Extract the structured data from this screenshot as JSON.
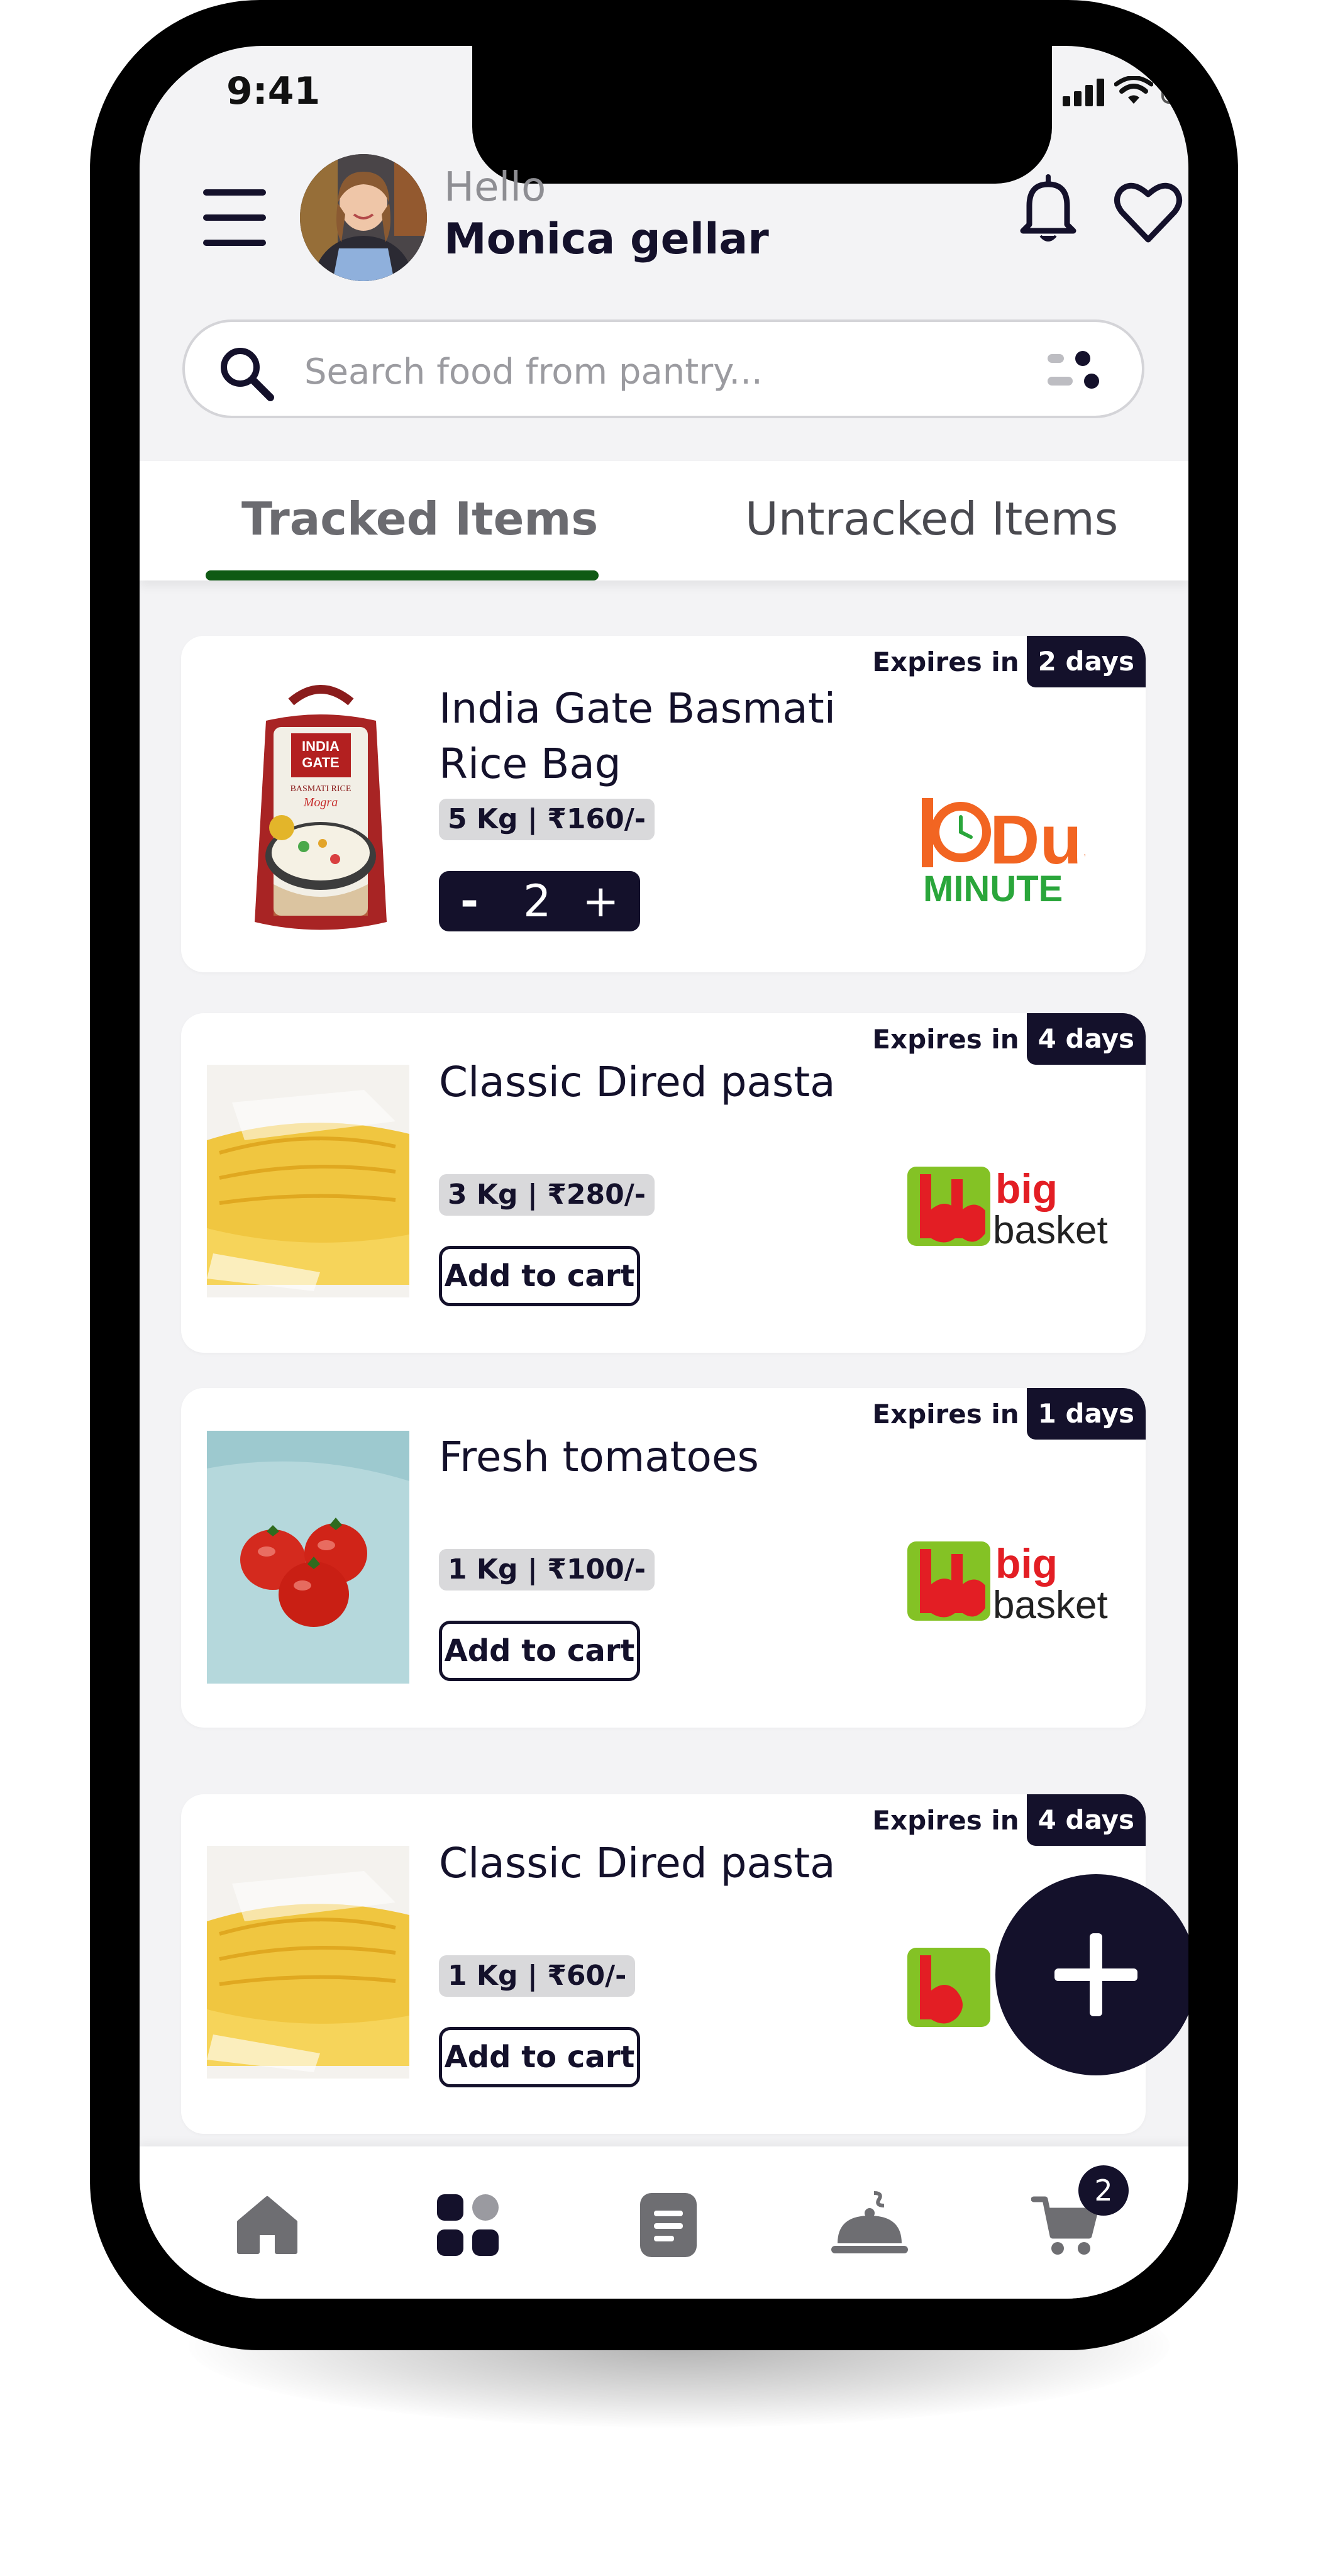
{
  "status_bar": {
    "time": "9:41"
  },
  "header": {
    "greeting": "Hello",
    "user_name": "Monica gellar"
  },
  "search": {
    "placeholder": "Search food from pantry..."
  },
  "tabs": [
    {
      "label": "Tracked Items",
      "active": true
    },
    {
      "label": "Untracked Items",
      "active": false
    }
  ],
  "items": [
    {
      "name_line1": "India Gate Basmati",
      "name_line2": "Rice Bag",
      "meta": "5 Kg | ₹160/-",
      "expires_label": "Expires in",
      "expires_value": "2 days",
      "quantity": "2",
      "stepper_minus": "-",
      "stepper_plus": "+",
      "store": "Dus Minute",
      "store_logo_text_1": "Dus",
      "store_logo_text_2": "MINUTE"
    },
    {
      "name": "Classic Dired pasta",
      "meta": "3 Kg | ₹280/-",
      "expires_label": "Expires in",
      "expires_value": "4 days",
      "action": "Add to cart",
      "store": "bigbasket",
      "store_logo_text_1": "big",
      "store_logo_text_2": "basket"
    },
    {
      "name": "Fresh tomatoes",
      "meta": "1 Kg | ₹100/-",
      "expires_label": "Expires in",
      "expires_value": "1 days",
      "action": "Add to cart",
      "store": "bigbasket",
      "store_logo_text_1": "big",
      "store_logo_text_2": "basket"
    },
    {
      "name": "Classic Dired pasta",
      "meta": "1 Kg | ₹60/-",
      "expires_label": "Expires in",
      "expires_value": "4 days",
      "action": "Add to cart",
      "store": "bigbasket"
    }
  ],
  "bottom_nav": {
    "items": [
      "home-icon",
      "grid-icon",
      "list-icon",
      "cloche-icon",
      "cart-icon"
    ],
    "active": "grid-icon",
    "cart_badge": "2"
  },
  "colors": {
    "primary": "#14112b",
    "accent_green": "#0f5a14",
    "chip": "#d9d9db",
    "dus_orange": "#f26522",
    "dus_green": "#2aa63b",
    "bb_green": "#84c225",
    "bb_red": "#e31e24"
  }
}
